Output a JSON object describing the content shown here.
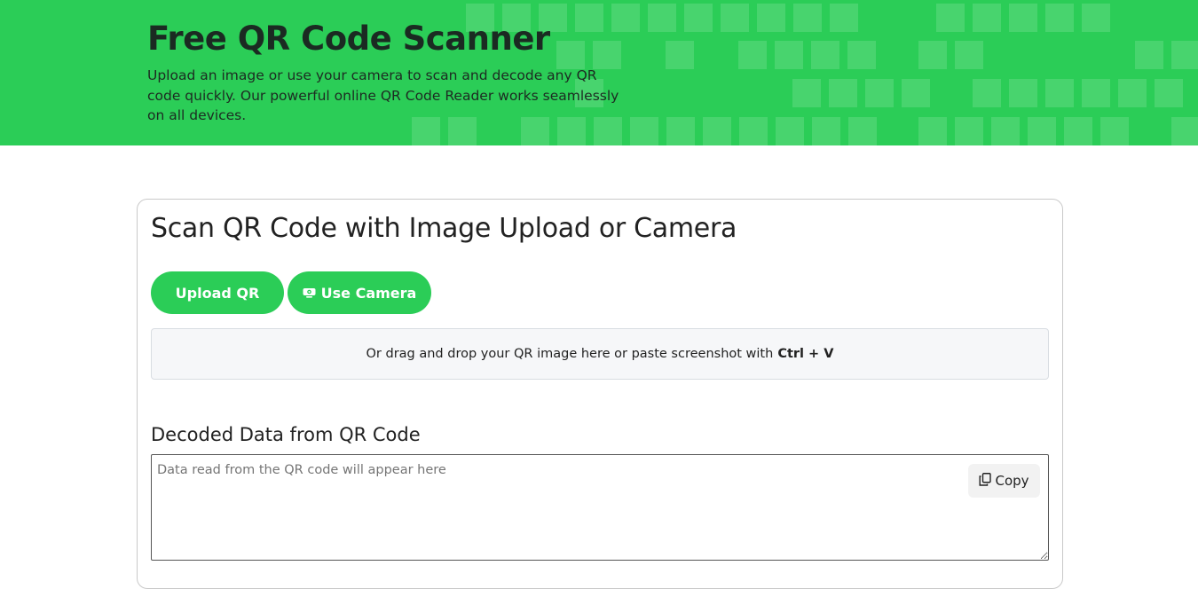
{
  "hero": {
    "title": "Free QR Code Scanner",
    "subtitle": "Upload an image or use your camera to scan and decode any QR code quickly. Our powerful online QR Code Reader works seamlessly on all devices.",
    "background_color": "#2bcd57"
  },
  "scanner": {
    "title": "Scan QR Code with Image Upload or Camera",
    "upload_button_label": "Upload QR",
    "camera_button_label": "Use Camera",
    "camera_icon": "webcam-icon",
    "dropzone_text": "Or drag and drop your QR image here or paste screenshot with",
    "dropzone_shortcut": "Ctrl + V"
  },
  "decoded": {
    "title": "Decoded Data from QR Code",
    "value": "",
    "placeholder": "Data read from the QR code will appear here",
    "copy_label": "Copy",
    "copy_icon": "copy-icon"
  }
}
